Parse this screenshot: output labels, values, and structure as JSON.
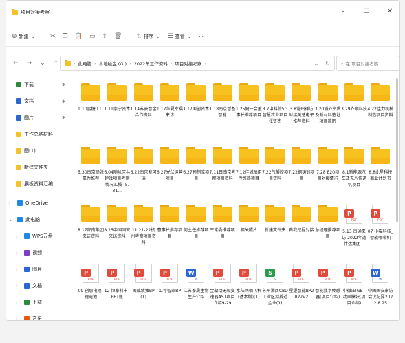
{
  "window": {
    "title": "项目对接考察",
    "controls": [
      "–",
      "☐",
      "✕"
    ]
  },
  "toolbar": {
    "new_label": "新建",
    "sort_label": "排序",
    "view_label": "查看",
    "more_label": "···"
  },
  "address": {
    "back": "←",
    "forward": "→",
    "down": "⌄",
    "up": "↑",
    "crumbs": [
      "此电脑",
      "本地磁盘 (G:)",
      "2022年工作资料",
      "项目对接考察"
    ],
    "search_placeholder": "在 项目对接考察..."
  },
  "sidebar": {
    "items": [
      {
        "label": "下载",
        "icon": "download-icon",
        "pin": true
      },
      {
        "label": "文档",
        "icon": "document-icon",
        "pin": true
      },
      {
        "label": "图片",
        "icon": "picture-icon",
        "pin": true
      },
      {
        "label": "工作总结材料",
        "icon": "folder-icon"
      },
      {
        "label": "图(1)",
        "icon": "folder-icon"
      },
      {
        "label": "新建文件夹",
        "icon": "folder-icon"
      },
      {
        "label": "展板资料汇编",
        "icon": "folder-icon"
      },
      {
        "label": "OneDrive",
        "icon": "cloud-icon"
      },
      {
        "label": "此电脑",
        "icon": "computer-icon"
      },
      {
        "label": "WPS云盘",
        "icon": "cloud-icon"
      },
      {
        "label": "视频",
        "icon": "video-icon"
      },
      {
        "label": "图片",
        "icon": "picture-icon"
      },
      {
        "label": "文档",
        "icon": "document-icon"
      },
      {
        "label": "下载",
        "icon": "download-icon"
      },
      {
        "label": "音乐",
        "icon": "music-icon"
      }
    ]
  },
  "files": [
    {
      "name": "1.10蜜糖工厂",
      "type": "folder"
    },
    {
      "name": "1.11崇宁资本",
      "type": "folder"
    },
    {
      "name": "1.14苏豪智金合作资料",
      "type": "folder"
    },
    {
      "name": "1.17华夏幸福来访",
      "type": "folder"
    },
    {
      "name": "1.17国创资本",
      "type": "folder"
    },
    {
      "name": "1.18南京哲基智能",
      "type": "folder"
    },
    {
      "name": "1.25健一会董事长推荐项目",
      "type": "folder"
    },
    {
      "name": "3.7中科院5G智慧农业项目 张贤杰",
      "type": "folder"
    },
    {
      "name": "3.8常州祥访对接美芝电子推荐资料",
      "type": "folder"
    },
    {
      "name": "3.20浦外资质及新材料选址项目简历",
      "type": "folder"
    },
    {
      "name": "3.29齐顺科技",
      "type": "folder"
    },
    {
      "name": "4.22佳力机械制造项目资料",
      "type": "folder"
    },
    {
      "name": "5.30南京局张氢为推荐",
      "type": "folder"
    },
    {
      "name": "6.04随从区共建社项目考察情况汇报 (5.31...",
      "type": "folder"
    },
    {
      "name": "6.22南京能可瑞",
      "type": "folder"
    },
    {
      "name": "6.27光伏运营项目",
      "type": "folder"
    },
    {
      "name": "6.27预制库项目",
      "type": "folder"
    },
    {
      "name": "7.11日南京考察项目资料",
      "type": "folder"
    },
    {
      "name": "7.12佳城柏用传感器项目",
      "type": "folder"
    },
    {
      "name": "7.22气凝胶项目资料",
      "type": "folder"
    },
    {
      "name": "7.22钢铸锻项目",
      "type": "folder"
    },
    {
      "name": "7.28 E20项目对接情况",
      "type": "folder"
    },
    {
      "name": "8.1新能源汽车及无人快递机项目",
      "type": "folder"
    },
    {
      "name": "8.8此星科技商业计划书",
      "type": "folder"
    },
    {
      "name": "8.17部南集团来访资料",
      "type": "folder"
    },
    {
      "name": "8.25中国国安来访资料",
      "type": "folder"
    },
    {
      "name": "11.21-22杭州考察项目资料",
      "type": "folder"
    },
    {
      "name": "曹事长推荐项目",
      "type": "folder"
    },
    {
      "name": "何主任推荐项目",
      "type": "folder"
    },
    {
      "name": "王常委推荐项目",
      "type": "folder"
    },
    {
      "name": "相关照片",
      "type": "folder"
    },
    {
      "name": "新建文件夹",
      "type": "folder"
    },
    {
      "name": "自我挖掘对接",
      "type": "folder"
    },
    {
      "name": "总经理推荐项目",
      "type": "folder"
    },
    {
      "name": "5.13 南通来访 2022年造什达集团...",
      "type": "pdf"
    },
    {
      "name": "07 小喵科技_智能咖啡机",
      "type": "pdf"
    },
    {
      "name": "09 创思电池_锂电池",
      "type": "pdf"
    },
    {
      "name": "12 恒泰科丰_PET瓶",
      "type": "pdf"
    },
    {
      "name": "国威致独BP(1)",
      "type": "pdf"
    },
    {
      "name": "汇荐智家BP",
      "type": "pdf"
    },
    {
      "name": "江苏泰晟生物 生产介绍",
      "type": "word"
    },
    {
      "name": "金勒动无极变速器AST项目介绍9-29",
      "type": "pdf"
    },
    {
      "name": "水陆两栖飞机(基本版)(1)",
      "type": "pdf"
    },
    {
      "name": "苏州湖西CBD工业区拟拆迁企业(1)",
      "type": "sheet"
    },
    {
      "name": "星逻智能BP2022V2",
      "type": "pdf"
    },
    {
      "name": "智能数字传感器(项目介绍)",
      "type": "pdf"
    },
    {
      "name": "中微压IGBT功率模块(项目介绍)",
      "type": "pdf"
    },
    {
      "name": "中国国安来访会议纪要2022.8.25",
      "type": "word"
    }
  ],
  "colors": {
    "folder": "#f7c21f",
    "pdf": "#e14b3b",
    "word": "#2b67d1",
    "sheet": "#2e9a4e"
  }
}
